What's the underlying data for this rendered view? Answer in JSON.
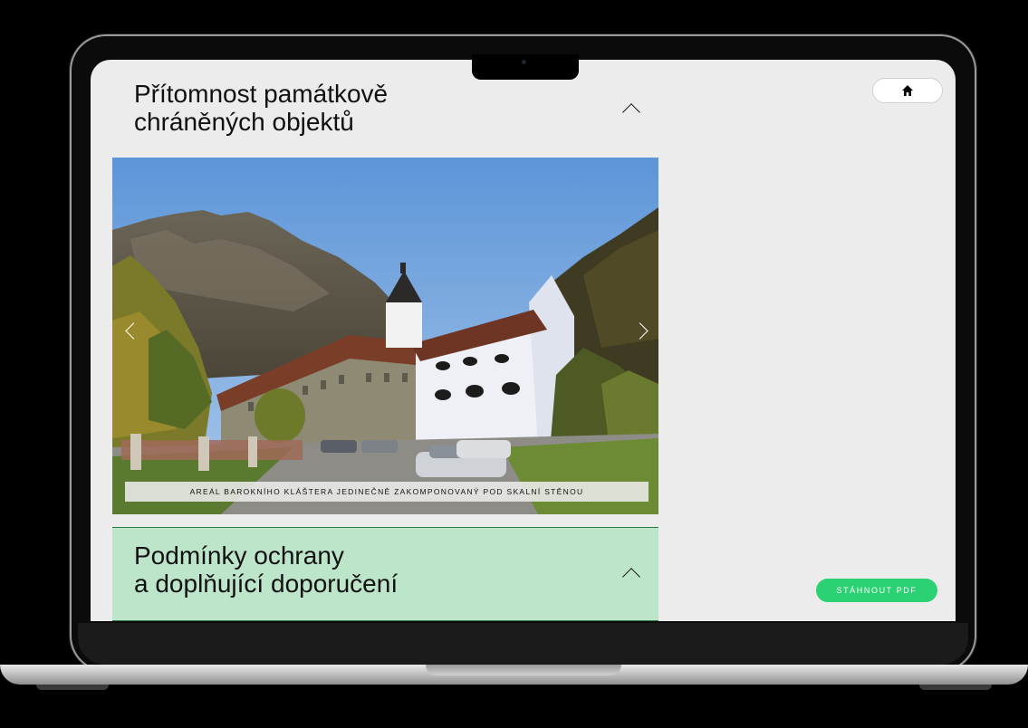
{
  "sections": [
    {
      "title_line1": "Přítomnost památkově",
      "title_line2": "chráněných objektů",
      "expanded": true
    },
    {
      "title_line1": "Podmínky ochrany",
      "title_line2": "a doplňující doporučení",
      "expanded": true
    }
  ],
  "gallery": {
    "caption": "AREÁL BAROKNÍHO KLÁŠTERA JEDINEČNĚ ZAKOMPONOVANÝ POD SKALNÍ STĚNOU"
  },
  "header": {
    "home_icon": "home-icon"
  },
  "actions": {
    "pdf_label": "STÁHNOUT PDF"
  },
  "colors": {
    "accent_green": "#2bd172",
    "panel_green": "#bde5ca",
    "screen_bg": "#ececec"
  }
}
